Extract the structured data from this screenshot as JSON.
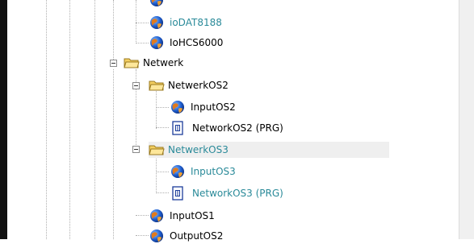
{
  "tree": {
    "nodes": {
      "iodat": {
        "label": "ioDAT8188",
        "icon": "globe-icon",
        "highlighted": true
      },
      "iohcs": {
        "label": "IoHCS6000",
        "icon": "globe-icon"
      },
      "netwerk": {
        "label": "Netwerk",
        "icon": "folder-open-icon"
      },
      "netwerkos2": {
        "label": "NetwerkOS2",
        "icon": "folder-open-icon"
      },
      "inputos2": {
        "label": "InputOS2",
        "icon": "globe-icon"
      },
      "networkos2prg": {
        "label": "NetworkOS2 (PRG)",
        "icon": "program-document-icon"
      },
      "netwerkos3": {
        "label": "NetwerkOS3",
        "icon": "folder-open-icon",
        "selected": true,
        "highlighted": true
      },
      "inputos3": {
        "label": "InputOS3",
        "icon": "globe-icon",
        "highlighted": true
      },
      "networkos3prg": {
        "label": "NetworkOS3 (PRG)",
        "icon": "program-document-icon",
        "highlighted": true
      },
      "inputos1": {
        "label": "InputOS1",
        "icon": "globe-icon"
      },
      "outputos2": {
        "label": "OutputOS2",
        "icon": "globe-icon"
      }
    }
  },
  "colors": {
    "highlight_text": "#2a8a99",
    "selection_bg": "#efefef",
    "left_border": "#111111"
  }
}
